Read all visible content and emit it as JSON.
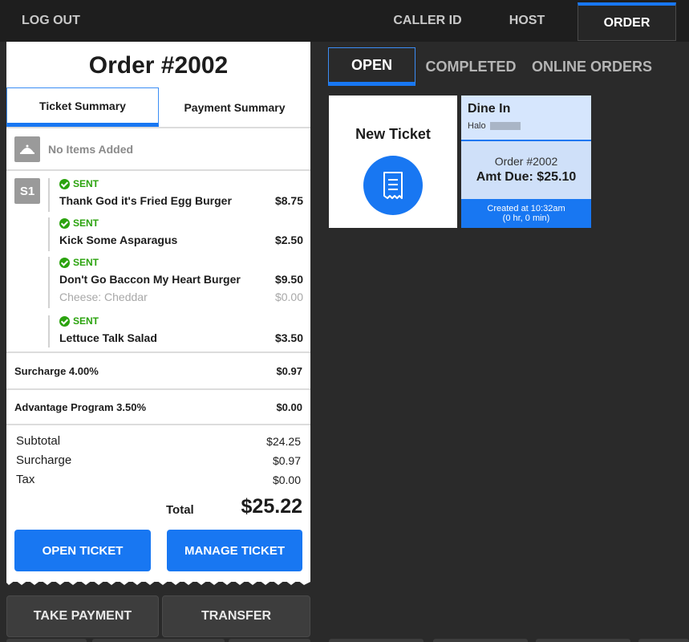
{
  "topbar": {
    "logout": "LOG OUT",
    "nav": [
      "CALLER ID",
      "HOST",
      "ORDER"
    ],
    "active_nav": "ORDER"
  },
  "order": {
    "title": "Order #2002",
    "tabs": [
      "Ticket Summary",
      "Payment Summary"
    ],
    "no_items": "No Items Added",
    "seat": "S1",
    "items": [
      {
        "status": "SENT",
        "name": "Thank God it's Fried Egg Burger",
        "price": "$8.75"
      },
      {
        "status": "SENT",
        "name": "Kick Some Asparagus",
        "price": "$2.50"
      },
      {
        "status": "SENT",
        "name": "Don't Go Baccon My Heart Burger",
        "price": "$9.50",
        "modifier": {
          "name": "Cheese: Cheddar",
          "price": "$0.00"
        }
      },
      {
        "status": "SENT",
        "name": "Lettuce Talk Salad",
        "price": "$3.50"
      }
    ],
    "fees": [
      {
        "label": "Surcharge 4.00%",
        "value": "$0.97"
      },
      {
        "label": "Advantage Program 3.50%",
        "value": "$0.00"
      }
    ],
    "summary": [
      {
        "label": "Subtotal",
        "value": "$24.25"
      },
      {
        "label": "Surcharge",
        "value": "$0.97"
      },
      {
        "label": "Tax",
        "value": "$0.00"
      }
    ],
    "total_label": "Total",
    "total_value": "$25.22",
    "open_ticket": "OPEN TICKET",
    "manage_ticket": "MANAGE TICKET"
  },
  "footer": {
    "take_payment": "TAKE PAYMENT",
    "transfer": "TRANSFER"
  },
  "right": {
    "tabs": [
      "OPEN",
      "COMPLETED",
      "ONLINE ORDERS"
    ],
    "active_tab": "OPEN",
    "new_ticket": "New Ticket",
    "card": {
      "type": "Dine In",
      "guest": "Halo",
      "order": "Order #2002",
      "amt_due": "Amt Due: $25.10",
      "created": "Created at 10:32am",
      "elapsed": "(0 hr, 0 min)"
    }
  },
  "colors": {
    "accent": "#1877f2",
    "sent": "#2ba30e",
    "background": "#2a2a2a"
  }
}
